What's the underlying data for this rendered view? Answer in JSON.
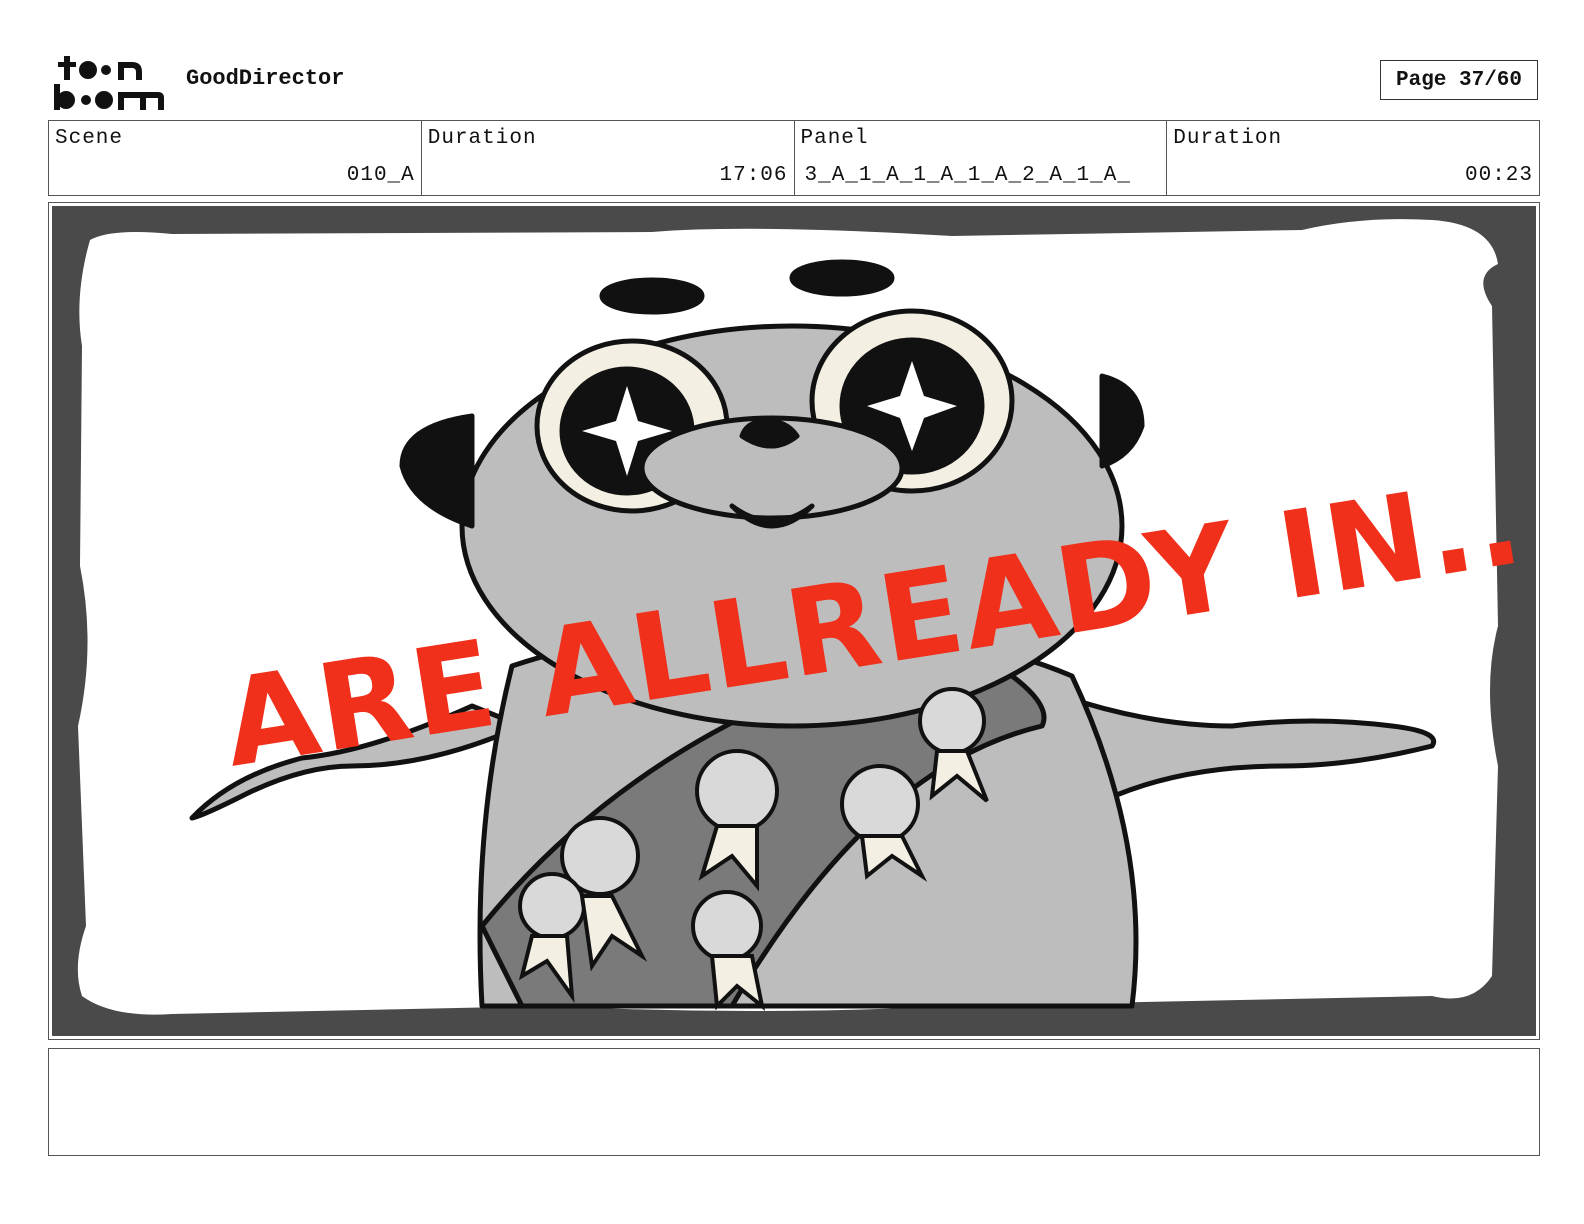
{
  "header": {
    "logo_text": "toon boom",
    "app_title": "GoodDirector",
    "page_label": "Page 37/60"
  },
  "info": {
    "scene_label": "Scene",
    "scene_value": "010_A",
    "duration_label": "Duration",
    "duration_value": "17:06",
    "panel_label": "Panel",
    "panel_value": "3_A_1_A_1_A_1_A_2_A_1_A_",
    "panel_duration_label": "Duration",
    "panel_duration_value": "00:23"
  },
  "panel": {
    "caption": "ARE ALLREADY IN...",
    "caption_color": "#f0301a",
    "frame_color": "#4a4a4a",
    "character_color": "#bdbdbd",
    "sash_color": "#7a7a7a"
  },
  "notes": {
    "text": ""
  }
}
